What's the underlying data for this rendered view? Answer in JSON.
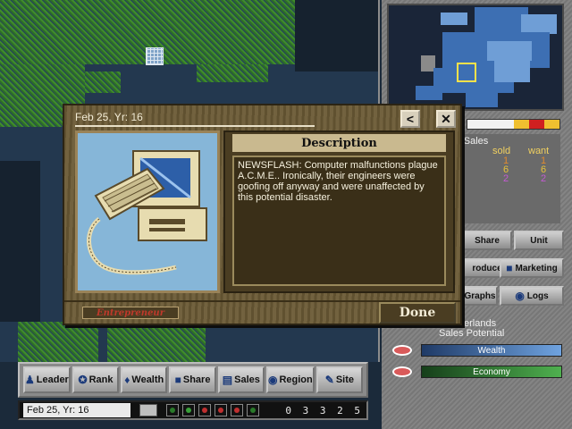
{
  "dialog": {
    "date": "Feb 25, Yr: 16",
    "back_glyph": "<",
    "close_glyph": "✕",
    "description_heading": "Description",
    "description_text": "NEWSFLASH: Computer malfunctions plague A.C.M.E.. Ironically, their engineers were goofing off anyway and were unaffected by this potential disaster.",
    "badge": "Entrepreneur",
    "done_label": "Done",
    "image_icon": "computer-icon"
  },
  "right_panel": {
    "sales_title": "nal Sales",
    "col_sold": "sold",
    "col_want": "want",
    "rows": [
      {
        "sold": "1",
        "want": "1",
        "color": "#e08a2e"
      },
      {
        "sold": "6",
        "want": "6",
        "color": "#e8c23a"
      },
      {
        "sold": "2",
        "want": "2",
        "color": "#c35ad2"
      }
    ],
    "color_strip": [
      "#f2f2f2",
      "#f2f2f2",
      "#f2f2f2",
      "#f0c030",
      "#d02020",
      "#f0c030"
    ],
    "buttons": {
      "share": "Share",
      "unit": "Unit",
      "produce": "roduce",
      "marketing": "Marketing",
      "graphs": "Graphs",
      "logs": "Logs"
    },
    "region_name": "erlands",
    "sales_potential": "Sales Potential",
    "wealth_label": "Wealth",
    "economy_label": "Economy",
    "wealth_color": "#3a6fb0",
    "economy_color": "#3a8a3a"
  },
  "toolbar": {
    "leader": "Leader",
    "rank": "Rank",
    "wealth": "Wealth",
    "share": "Share",
    "sales": "Sales",
    "region": "Region",
    "site": "Site"
  },
  "status": {
    "date": "Feb 25, Yr: 16",
    "money": "0 3 3 2 5"
  }
}
